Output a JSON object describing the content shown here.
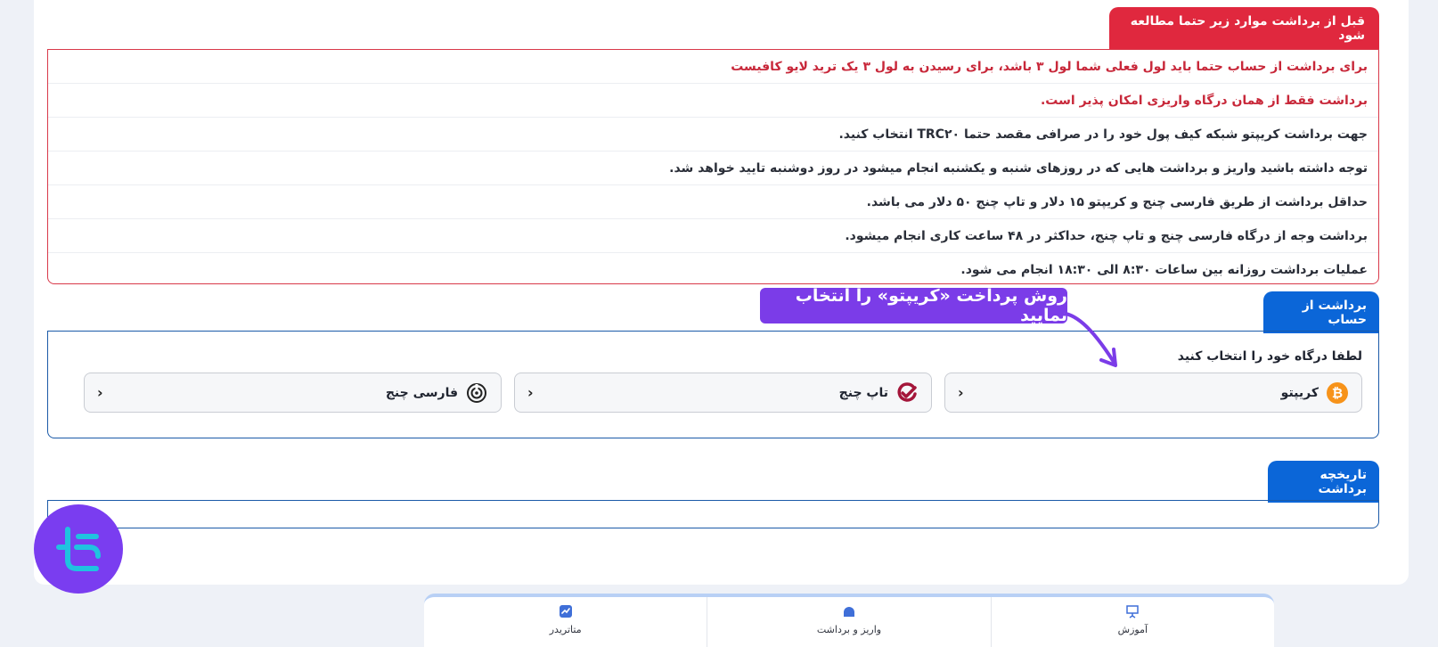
{
  "notice": {
    "title": "قبل از برداشت موارد زیر حتما مطالعه شود",
    "items": [
      "برای برداشت از حساب حتما باید لول فعلی شما لول ۳ باشد، برای رسیدن به لول ۳ یک ترید لایو کافیست",
      "برداشت فقط از همان درگاه واریزی امکان پذیر است.",
      "جهت برداشت کریپتو شبکه کیف پول خود را در صرافی مقصد حتما TRC۲۰ انتخاب کنید.",
      "توجه داشته باشید واریز و برداشت هایی که در روزهای شنبه و یکشنبه انجام میشود در روز دوشنبه تایید خواهد شد.",
      "حداقل برداشت از طریق فارسی چنج و کریپتو ۱۵ دلار و تاپ چنج ۵۰ دلار می باشد.",
      "برداشت وجه از درگاه فارسی چنج و تاپ چنج، حداکثر در ۴۸ ساعت کاری انجام میشود.",
      "عملیات برداشت روزانه بین ساعات ۸:۳۰ الی ۱۸:۳۰ انجام می شود."
    ],
    "red_item_count": 2
  },
  "withdraw": {
    "title": "برداشت از حساب",
    "choose_label": "لطفا درگاه خود را انتخاب کنید",
    "gateways": [
      {
        "label": "کریپتو",
        "icon": "bitcoin-icon"
      },
      {
        "label": "تاپ چنج",
        "icon": "topchange-logo-icon"
      },
      {
        "label": "فارسی چنج",
        "icon": "farsichange-logo-icon"
      }
    ]
  },
  "history": {
    "title": "تاریخچه برداشت"
  },
  "callout": {
    "text": "روش پرداخت «کریپتو» را انتخاب نمایید"
  },
  "bottom_nav": {
    "items": [
      {
        "label": "متاتریدر",
        "icon": "chart-icon"
      },
      {
        "label": "واریز و برداشت",
        "icon": "wallet-icon"
      },
      {
        "label": "آموزش",
        "icon": "presentation-icon"
      }
    ]
  },
  "colors": {
    "danger": "#e0283e",
    "primary": "#0b66d8",
    "callout": "#7b3ce8"
  }
}
